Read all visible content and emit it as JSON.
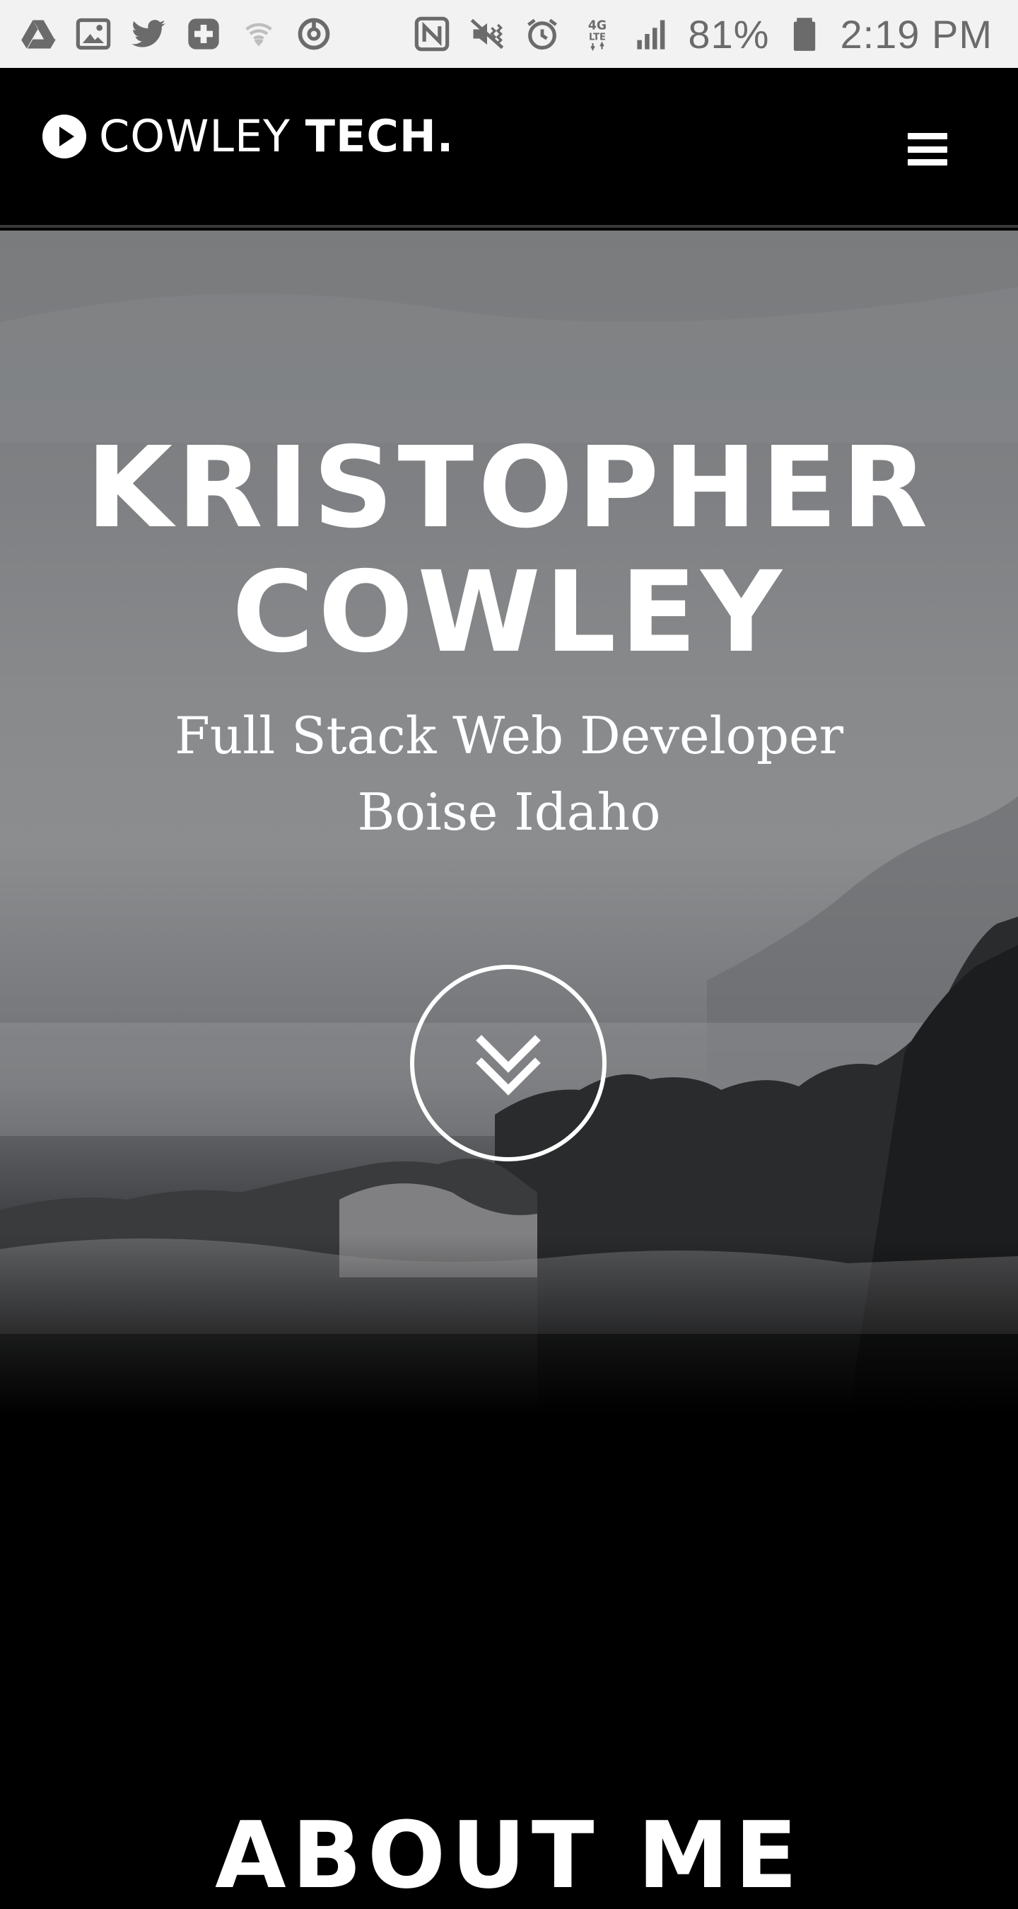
{
  "status_bar": {
    "battery": "81%",
    "time": "2:19 PM",
    "network": "4G LTE",
    "left_icons": [
      "drive-icon",
      "gallery-icon",
      "twitter-icon",
      "health-plus-icon",
      "wifi-icon",
      "sync-icon"
    ],
    "right_icons": [
      "nfc-icon",
      "mute-vibrate-icon",
      "alarm-icon",
      "lte-icon",
      "signal-icon",
      "battery-icon"
    ]
  },
  "header": {
    "brand_light": "COWLEY",
    "brand_bold": "TECH.",
    "logo_icon": "play-circle-icon",
    "menu_icon": "hamburger-menu-icon"
  },
  "hero": {
    "title_line1": "KRISTOPHER",
    "title_line2": "COWLEY",
    "subtitle_line1": "Full Stack Web Developer",
    "subtitle_line2": "Boise Idaho",
    "scroll_icon": "double-chevron-down-icon"
  },
  "about": {
    "title": "ABOUT ME"
  },
  "colors": {
    "header_bg": "#000000",
    "status_bar_bg": "#f2f2f2",
    "status_text": "#6b6b6b",
    "hero_text": "#ffffff"
  }
}
